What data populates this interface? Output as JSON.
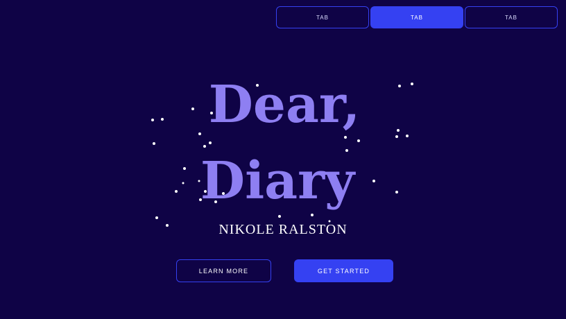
{
  "tabs": [
    {
      "label": "TAB",
      "active": false
    },
    {
      "label": "TAB",
      "active": true
    },
    {
      "label": "TAB",
      "active": false
    }
  ],
  "hero": {
    "title_line1": "Dear,",
    "title_line2": "Diary",
    "author": "NIKOLE RALSTON"
  },
  "buttons": {
    "learn_more": "LEARN MORE",
    "get_started": "GET STARTED"
  },
  "colors": {
    "background": "#0f0346",
    "accent": "#3541f2",
    "title": "#8e7ff2",
    "text": "#ffffff"
  }
}
